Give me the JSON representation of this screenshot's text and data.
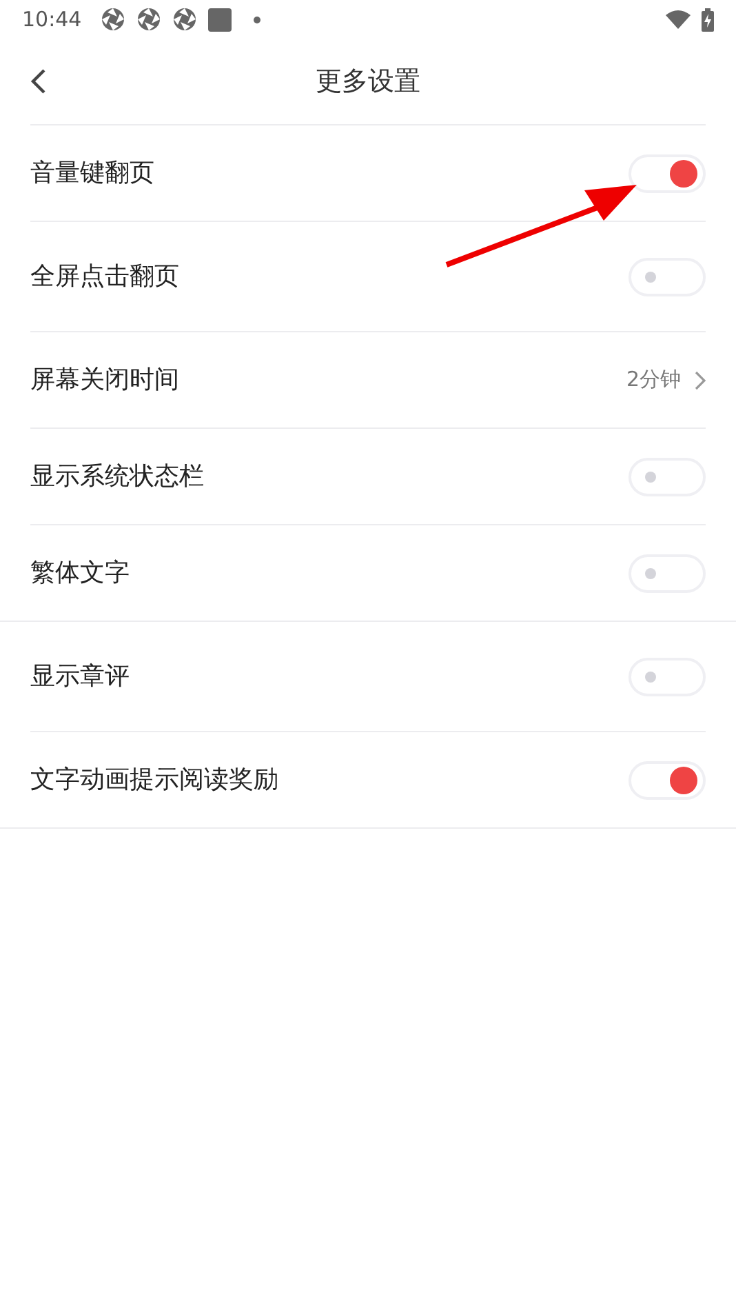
{
  "status_bar": {
    "time": "10:44"
  },
  "header": {
    "title": "更多设置"
  },
  "settings": [
    {
      "kind": "toggle",
      "label": "音量键翻页",
      "on": true
    },
    {
      "kind": "toggle",
      "label": "全屏点击翻页",
      "on": false
    },
    {
      "kind": "value",
      "label": "屏幕关闭时间",
      "value": "2分钟"
    },
    {
      "kind": "toggle",
      "label": "显示系统状态栏",
      "on": false
    },
    {
      "kind": "toggle",
      "label": "繁体文字",
      "on": false,
      "full_divider": true
    },
    {
      "kind": "toggle",
      "label": "显示章评",
      "on": false
    },
    {
      "kind": "toggle",
      "label": "文字动画提示阅读奖励",
      "on": true,
      "full_divider": true
    }
  ]
}
